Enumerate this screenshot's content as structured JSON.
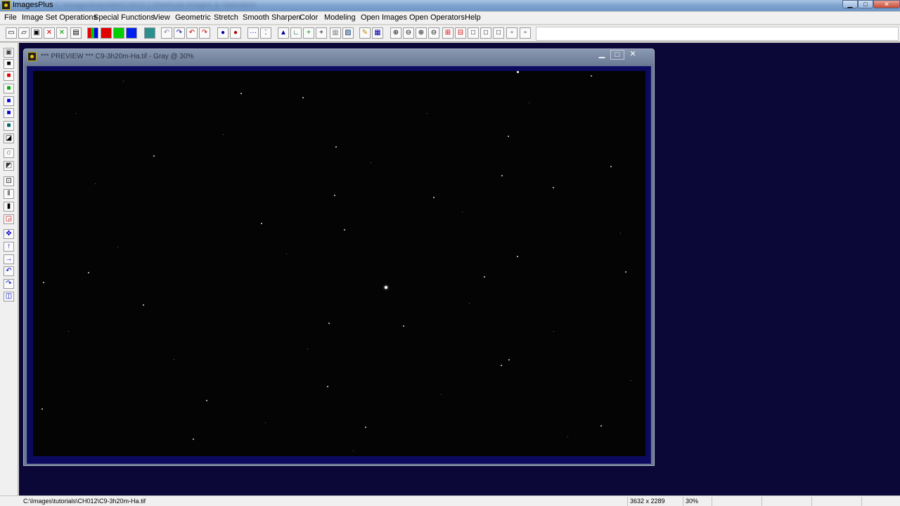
{
  "app": {
    "title": "ImagesPlus",
    "blurred_title": "[ C:\\Images\\tutorials\\CH012 ]  Shortcuts  Images & Operators"
  },
  "menu": [
    "File",
    "Image Set Operations",
    "Special Functions",
    "View",
    "Geometric",
    "Stretch",
    "Smooth Sharpen",
    "Color",
    "Modeling",
    "Open Images",
    "Open Operators",
    "Help"
  ],
  "window_controls": {
    "minimize": "▁",
    "maximize": "□",
    "close": "✕"
  },
  "child_window": {
    "title": "*** PREVIEW *** C9-3h20m-Ha.tif - Gray @ 30%",
    "minimize": "▁",
    "maximize": "□",
    "close": "✕"
  },
  "status": {
    "path": "C:\\Images\\tutorials\\CH012\\C9-3h20m-Ha.tif",
    "dimensions": "3632 x 2289",
    "zoom": "30%"
  },
  "colors": {
    "mdi_background": "#0b0838",
    "frame": "#0b0a5e",
    "image_background": "#040404"
  },
  "image_content": {
    "subject": "star field",
    "brightest_star_fraction": [
      0.576,
      0.563
    ]
  }
}
